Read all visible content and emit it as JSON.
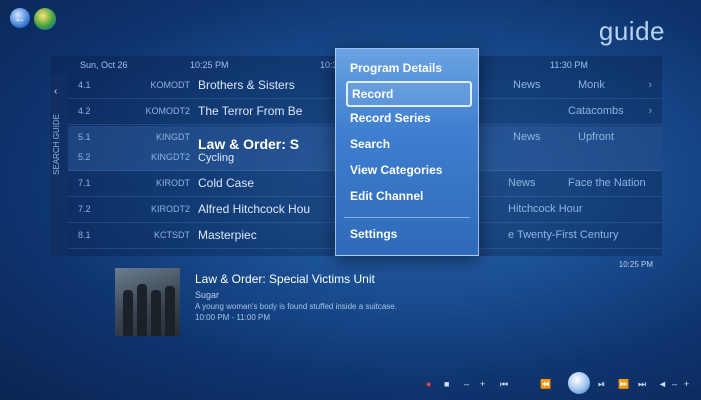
{
  "app": {
    "title": "guide"
  },
  "top_icons": [
    "back-icon",
    "start-orb-icon"
  ],
  "grid": {
    "date": "Sun, Oct 26",
    "time_1": "10:25 PM",
    "time_2": "10:3",
    "time_3": "11:30 PM",
    "side_label": "SEARCH GUIDE",
    "rows": [
      {
        "num": "4.1",
        "call": "KOMODT",
        "prog": "Brothers & Sisters",
        "right1": "News",
        "right2": "Monk"
      },
      {
        "num": "4.2",
        "call": "KOMODT2",
        "prog": "The Terror From Be",
        "right1": "",
        "right2": "Catacombs"
      },
      {
        "num": "5.1",
        "call": "KINGDT",
        "prog": "",
        "right1": "News",
        "right2": "Upfront"
      },
      {
        "num": "5.2",
        "call": "KINGDT2",
        "prog": "Law & Order: S",
        "prog_sub": "Cycling",
        "right1": "",
        "right2": ""
      },
      {
        "num": "7.1",
        "call": "KIRODT",
        "prog": "Cold Case",
        "right1": "News",
        "right2": "Face the Nation"
      },
      {
        "num": "7.2",
        "call": "KIRODT2",
        "prog": "Alfred Hitchcock Hou",
        "right1": "Hitchcock Hour",
        "right2": ""
      },
      {
        "num": "8.1",
        "call": "KCTSDT",
        "prog": "Masterpiec",
        "right1": "e Twenty-First Century",
        "right2": ""
      }
    ]
  },
  "menu": {
    "items": [
      "Program Details",
      "Record",
      "Record Series",
      "Search",
      "View Categories",
      "Edit Channel",
      "Settings"
    ],
    "focused": "Record"
  },
  "detail": {
    "title": "Law & Order: Special Victims Unit",
    "episode": "Sugar",
    "description": "A young woman's body is found stuffed inside a suitcase.",
    "time": "10:00 PM - 11:00 PM",
    "now_time": "10:25 PM"
  },
  "transport": {
    "buttons": [
      "record-icon",
      "stop-icon",
      "volume-down-icon",
      "volume-up-icon",
      "skip-back-icon",
      "rewind-icon",
      "media-center-orb-icon",
      "play-pause-icon",
      "fast-forward-icon",
      "skip-forward-icon",
      "mute-icon",
      "channel-down-icon",
      "channel-up-icon"
    ]
  }
}
